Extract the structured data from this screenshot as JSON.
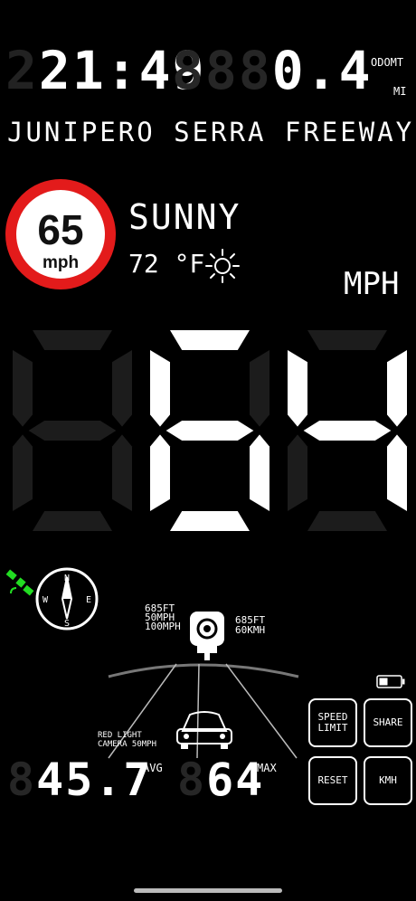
{
  "clock": {
    "ghost": "2",
    "time": "21:49"
  },
  "odometer": {
    "ghost": "888",
    "value": "0.4",
    "label": "ODOMT",
    "unit": "MI"
  },
  "street": "JUNIPERO SERRA FREEWAY",
  "speed_limit_sign": {
    "value": "65",
    "unit": "mph"
  },
  "weather": {
    "condition": "SUNNY",
    "temperature": "72 °F",
    "icon": "sun-icon"
  },
  "speed": {
    "unit": "MPH",
    "value": "64",
    "ghost_digit": "8"
  },
  "compass": {
    "letters": [
      "N",
      "E",
      "S",
      "W"
    ],
    "icon": "compass-icon"
  },
  "gps": {
    "icon": "satellite-icon",
    "color": "#22dd22"
  },
  "camera": {
    "left_lines": [
      "685FT",
      "50MPH",
      "100MPH"
    ],
    "right_lines": [
      "685FT",
      "60KMH"
    ],
    "alert": [
      "RED LIGHT",
      "CAMERA 50MPH"
    ],
    "icon": "speed-camera-icon"
  },
  "stats": {
    "avg": {
      "ghost": "8",
      "value": "45.7",
      "label": "AVG"
    },
    "max": {
      "ghost": "8",
      "value": "64",
      "label": "MAX"
    }
  },
  "buttons": {
    "speed_limit": "SPEED LIMIT",
    "share": "SHARE",
    "reset": "RESET",
    "kmh": "KMH"
  },
  "colors": {
    "limit_ring": "#e31b1b",
    "background": "#000000",
    "gps": "#22dd22"
  }
}
